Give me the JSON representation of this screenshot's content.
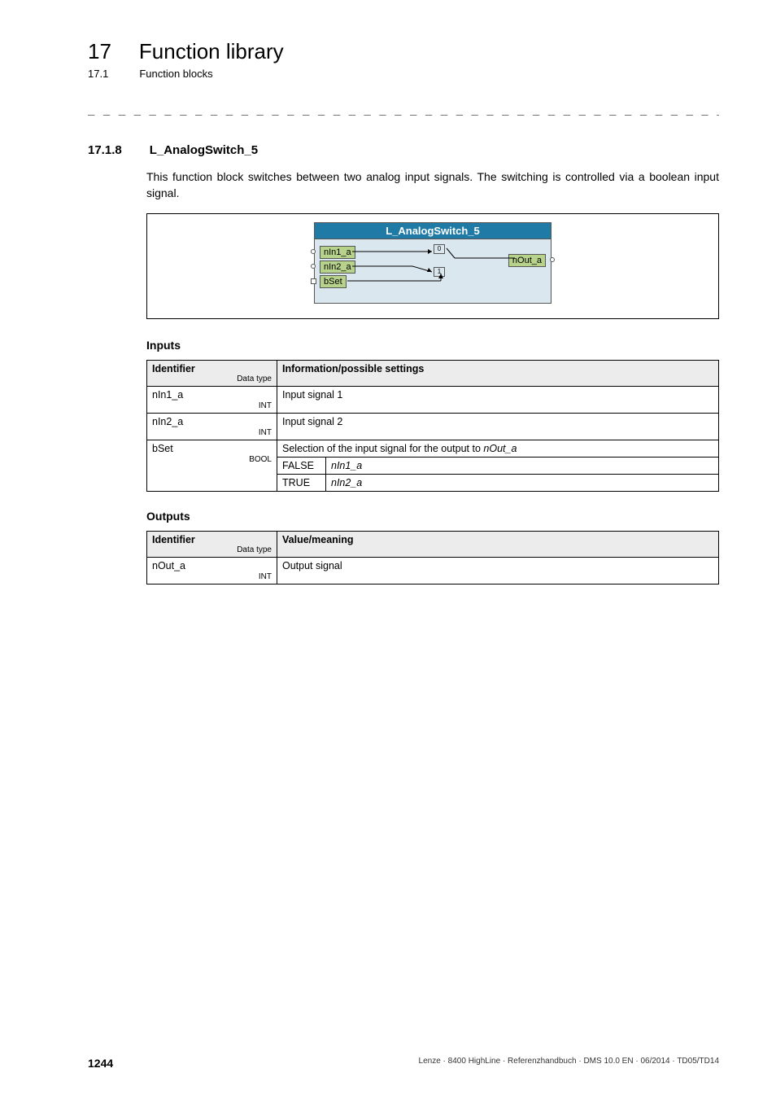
{
  "header": {
    "chapter_num": "17",
    "chapter_title": "Function library",
    "section_num": "17.1",
    "section_title": "Function blocks"
  },
  "dashes": "_ _ _ _ _ _ _ _ _ _ _ _ _ _ _ _ _ _ _ _ _ _ _ _ _ _ _ _ _ _ _ _ _ _ _ _ _ _ _ _ _ _ _ _ _ _ _ _ _ _ _ _ _ _ _ _ _ _ _ _ _ _ _ _",
  "subsection": {
    "num": "17.1.8",
    "title": "L_AnalogSwitch_5"
  },
  "body_text": "This function block switches between two analog input signals. The switching is controlled via a boolean input signal.",
  "block": {
    "title": "L_AnalogSwitch_5",
    "in1": "nIn1_a",
    "in2": "nIn2_a",
    "bset": "bSet",
    "out": "nOut_a",
    "sw0": "0",
    "sw1": "1"
  },
  "inputs_heading": "Inputs",
  "outputs_heading": "Outputs",
  "inputs_table": {
    "header_ident": "Identifier",
    "header_datatype": "Data type",
    "header_info": "Information/possible settings",
    "rows": [
      {
        "ident": "nIn1_a",
        "datatype": "INT",
        "info": "Input signal 1"
      },
      {
        "ident": "nIn2_a",
        "datatype": "INT",
        "info": "Input signal 2"
      }
    ],
    "bset": {
      "ident": "bSet",
      "datatype": "BOOL",
      "info": "Selection of the input signal for the output to ",
      "info_italic": "nOut_a",
      "false_label": "FALSE",
      "false_val": "nIn1_a",
      "true_label": "TRUE",
      "true_val": "nIn2_a"
    }
  },
  "outputs_table": {
    "header_ident": "Identifier",
    "header_datatype": "Data type",
    "header_value": "Value/meaning",
    "rows": [
      {
        "ident": "nOut_a",
        "datatype": "INT",
        "value": "Output signal"
      }
    ]
  },
  "footer": {
    "page": "1244",
    "text": "Lenze · 8400 HighLine · Referenzhandbuch · DMS 10.0 EN · 06/2014 · TD05/TD14"
  }
}
